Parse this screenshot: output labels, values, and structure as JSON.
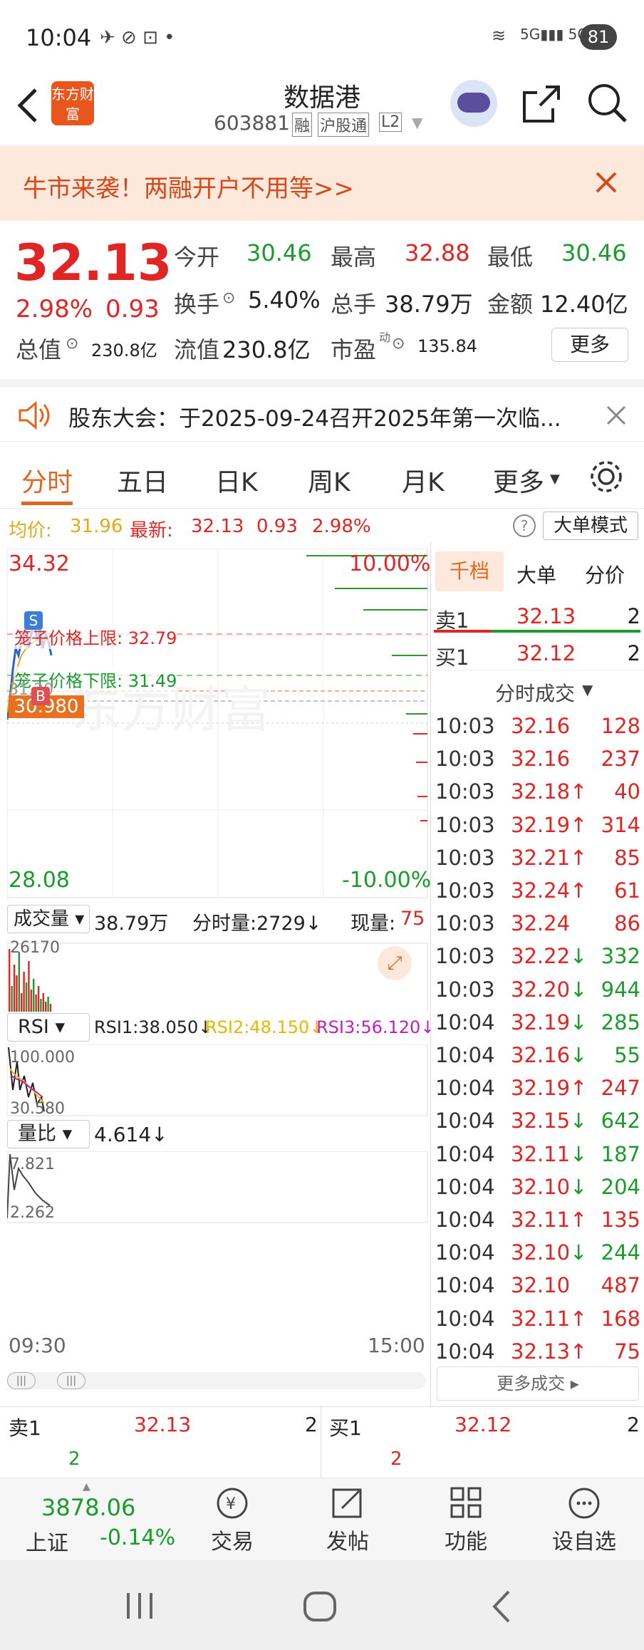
{
  "status_bar": {
    "time": "10:04",
    "battery": "81",
    "network": "5G"
  },
  "header": {
    "logo": "东方财富",
    "title": "数据港",
    "code": "603881",
    "tags": [
      "融",
      "沪股通",
      "L2"
    ]
  },
  "promo": {
    "text": "牛市来袭！两融开户不用等>>"
  },
  "quote": {
    "price": "32.13",
    "change_pct": "2.98%",
    "change": "0.93",
    "open_label": "今开",
    "open": "30.46",
    "high_label": "最高",
    "high": "32.88",
    "low_label": "最低",
    "low": "30.46",
    "turnover_label": "换手",
    "turnover": "5.40%",
    "volume_label": "总手",
    "volume": "38.79万",
    "amount_label": "金额",
    "amount": "12.40亿",
    "mcap_label": "总值",
    "mcap": "230.8亿",
    "float_label": "流值",
    "float": "230.8亿",
    "pe_label": "市盈",
    "pe_sup": "动",
    "pe": "135.84",
    "more_label": "更多"
  },
  "notice": {
    "text": "股东大会：于2025-09-24召开2025年第一次临..."
  },
  "tabs": [
    {
      "label": "分时"
    },
    {
      "label": "五日"
    },
    {
      "label": "日K"
    },
    {
      "label": "周K"
    },
    {
      "label": "月K"
    },
    {
      "label": "更多"
    }
  ],
  "intraday": {
    "avg_label": "均价:",
    "avg": "31.96",
    "latest_label": "最新:",
    "latest": "32.13",
    "chg": "0.93",
    "pct": "2.98%",
    "mode_label": "大单模式",
    "top_price": "34.32",
    "top_pct": "10.00%",
    "bottom_price": "28.08",
    "bottom_pct": "-10.00%",
    "upper_limit_label": "笼子价格上限: 32.79",
    "lower_limit_label": "笼子价格下限: 31.49",
    "current_tag": "30.980",
    "hidden_label": "31.20",
    "s_marker": "S",
    "b_marker": "B",
    "start_time": "09:30",
    "end_time": "15:00",
    "watermark": "东方财富"
  },
  "volume_panel": {
    "label": "成交量",
    "total": "38.79万",
    "fen_label": "分时量:2729↓",
    "now_label": "现量:",
    "now": "75",
    "max": "26170"
  },
  "rsi_panel": {
    "label": "RSI",
    "rsi1": "RSI1:38.050↓",
    "rsi2": "RSI2:48.150↓",
    "rsi3": "RSI3:56.120↓",
    "top": "100.000",
    "bottom": "30.580"
  },
  "ratio_panel": {
    "label": "量比",
    "value": "4.614↓",
    "top": "7.821",
    "bottom": "2.262"
  },
  "order_book": {
    "tabs": [
      "千档",
      "大单",
      "分价"
    ],
    "sell1_label": "卖1",
    "sell1_price": "32.13",
    "sell1_vol": "2",
    "buy1_label": "买1",
    "buy1_price": "32.12",
    "buy1_vol": "2",
    "ticks_title": "分时成交",
    "ticks": [
      {
        "t": "10:03",
        "p": "32.16",
        "a": "",
        "v": "128",
        "c": "red"
      },
      {
        "t": "10:03",
        "p": "32.16",
        "a": "",
        "v": "237",
        "c": "red"
      },
      {
        "t": "10:03",
        "p": "32.18",
        "a": "↑",
        "v": "40",
        "c": "red"
      },
      {
        "t": "10:03",
        "p": "32.19",
        "a": "↑",
        "v": "314",
        "c": "red"
      },
      {
        "t": "10:03",
        "p": "32.21",
        "a": "↑",
        "v": "85",
        "c": "red"
      },
      {
        "t": "10:03",
        "p": "32.24",
        "a": "↑",
        "v": "61",
        "c": "red"
      },
      {
        "t": "10:03",
        "p": "32.24",
        "a": "",
        "v": "86",
        "c": "red"
      },
      {
        "t": "10:03",
        "p": "32.22",
        "a": "↓",
        "v": "332",
        "c": "green"
      },
      {
        "t": "10:03",
        "p": "32.20",
        "a": "↓",
        "v": "944",
        "c": "green"
      },
      {
        "t": "10:04",
        "p": "32.19",
        "a": "↓",
        "v": "285",
        "c": "green"
      },
      {
        "t": "10:04",
        "p": "32.16",
        "a": "↓",
        "v": "55",
        "c": "green"
      },
      {
        "t": "10:04",
        "p": "32.19",
        "a": "↑",
        "v": "247",
        "c": "red"
      },
      {
        "t": "10:04",
        "p": "32.15",
        "a": "↓",
        "v": "642",
        "c": "green"
      },
      {
        "t": "10:04",
        "p": "32.11",
        "a": "↓",
        "v": "187",
        "c": "green"
      },
      {
        "t": "10:04",
        "p": "32.10",
        "a": "↓",
        "v": "204",
        "c": "green"
      },
      {
        "t": "10:04",
        "p": "32.11",
        "a": "↑",
        "v": "135",
        "c": "red"
      },
      {
        "t": "10:04",
        "p": "32.10",
        "a": "↓",
        "v": "244",
        "c": "green"
      },
      {
        "t": "10:04",
        "p": "32.10",
        "a": "",
        "v": "487",
        "c": "red"
      },
      {
        "t": "10:04",
        "p": "32.11",
        "a": "↑",
        "v": "168",
        "c": "red"
      },
      {
        "t": "10:04",
        "p": "32.13",
        "a": "↑",
        "v": "75",
        "c": "red"
      }
    ],
    "more_label": "更多成交"
  },
  "bottom_book": {
    "sell_label": "卖1",
    "sell_price": "32.13",
    "sell_vol": "2",
    "sell_sub": "2",
    "buy_label": "买1",
    "buy_price": "32.12",
    "buy_vol": "2",
    "buy_sub": "2"
  },
  "bottom_nav": {
    "index_value": "3878.06",
    "index_name": "上证",
    "index_change": "-0.14%",
    "items": [
      {
        "label": "交易"
      },
      {
        "label": "发帖"
      },
      {
        "label": "功能"
      },
      {
        "label": "设自选"
      }
    ]
  },
  "colors": {
    "up": "#e02525",
    "down": "#1a9c2c",
    "accent": "#e0661f"
  }
}
